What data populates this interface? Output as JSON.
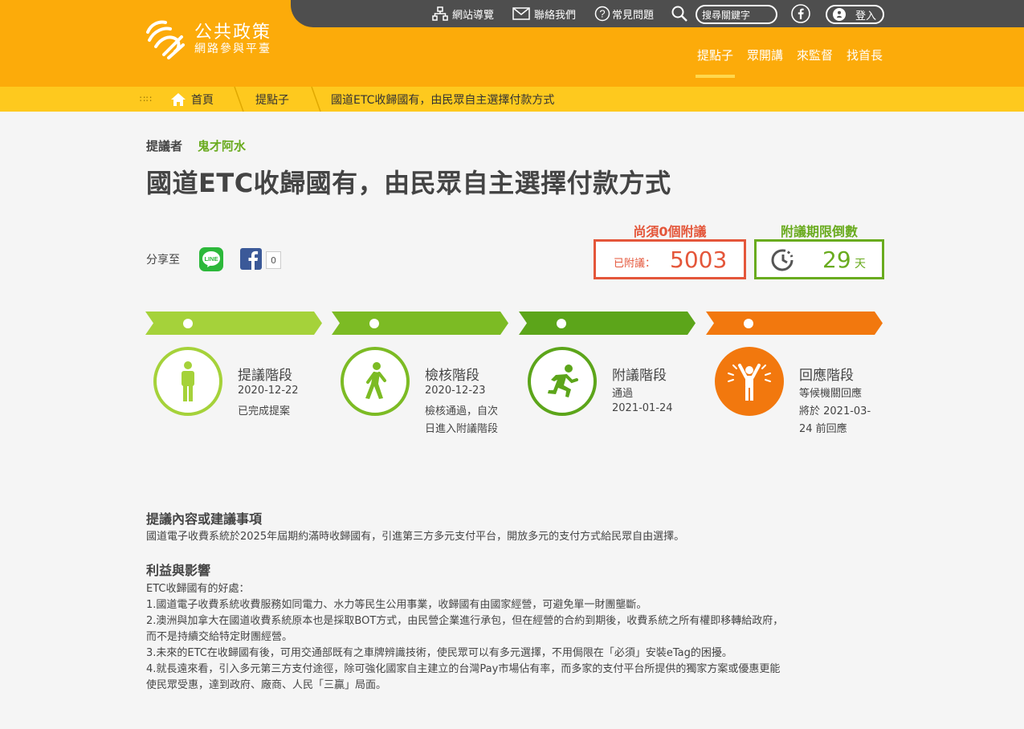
{
  "topbar": {
    "sitemap": "網站導覽",
    "contact": "聯絡我們",
    "faq": "常見問題",
    "search_placeholder": "搜尋關鍵字",
    "login": "登入"
  },
  "logo": {
    "line1": "公共政策",
    "line2": "網路參與平臺"
  },
  "nav": [
    "提點子",
    "眾開講",
    "來監督",
    "找首長"
  ],
  "breadcrumb": {
    "home": "首頁",
    "level1": "提點子",
    "current": "國道ETC收歸國有，由民眾自主選擇付款方式"
  },
  "proposal": {
    "proposer_label": "提議者",
    "proposer_name": "鬼才阿水",
    "title": "國道ETC收歸國有，由民眾自主選擇付款方式"
  },
  "share": {
    "label": "分享至",
    "fb_count": "0"
  },
  "stats": {
    "need_label": "尚須0個附議",
    "signed_label": "已附議：",
    "signed_value": "5003",
    "countdown_label": "附議期限倒數",
    "countdown_value": "29",
    "countdown_unit": "天"
  },
  "colors": {
    "header": "#fcab0a",
    "breadcrumb": "#fec91e",
    "stage1": "#a5d23a",
    "stage2": "#7cbb24",
    "stage3": "#5ca51a",
    "stage4": "#f2780e",
    "need": "#e4563a",
    "countdown": "#69ab1e"
  },
  "stages": [
    {
      "title": "提議階段",
      "icon": "person-standing-icon",
      "lines": [
        "2020-12-22",
        "已完成提案"
      ]
    },
    {
      "title": "檢核階段",
      "icon": "person-walking-icon",
      "lines": [
        "2020-12-23",
        "檢核通過，自次",
        "日進入附議階段"
      ]
    },
    {
      "title": "附議階段",
      "icon": "person-running-icon",
      "lines": [
        "通過",
        "2021-01-24"
      ]
    },
    {
      "title": "回應階段",
      "icon": "person-cheering-icon",
      "lines": [
        "等候機關回應",
        "將於  2021-03-",
        "24  前回應"
      ]
    }
  ],
  "content": {
    "h1": "提議內容或建議事項",
    "p1": "國道電子收費系統於2025年屆期約滿時收歸國有，引進第三方多元支付平台，開放多元的支付方式給民眾自由選擇。",
    "h2": "利益與影響",
    "lines": [
      "ETC收歸國有的好處：",
      "1.國道電子收費系統收費服務如同電力、水力等民生公用事業，收歸國有由國家經營，可避免單一財團壟斷。",
      "2.澳洲與加拿大在國道收費系統原本也是採取BOT方式，由民營企業進行承包，但在經營的合約到期後，收費系統之所有權即移轉給政府，",
      "而不是持續交給特定財團經營。",
      "3.未來的ETC在收歸國有後，可用交通部既有之車牌辨識技術，使民眾可以有多元選擇，不用侷限在「必須」安裝eTag的困擾。",
      "4.就長遠來看，引入多元第三方支付途徑，除可強化國家自主建立的台灣Pay市場佔有率，而多家的支付平台所提供的獨家方案或優惠更能",
      "使民眾受惠，達到政府、廠商、人民「三贏」局面。"
    ]
  }
}
